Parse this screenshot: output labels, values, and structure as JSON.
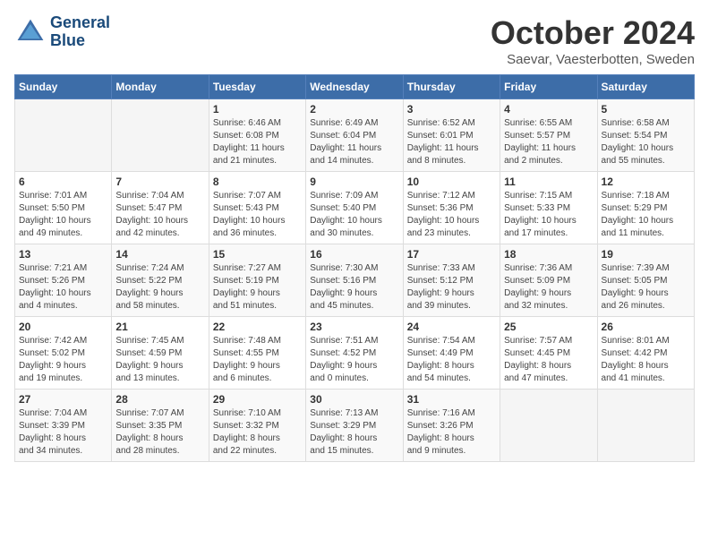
{
  "header": {
    "logo_line1": "General",
    "logo_line2": "Blue",
    "month": "October 2024",
    "location": "Saevar, Vaesterbotten, Sweden"
  },
  "weekdays": [
    "Sunday",
    "Monday",
    "Tuesday",
    "Wednesday",
    "Thursday",
    "Friday",
    "Saturday"
  ],
  "weeks": [
    [
      {
        "day": "",
        "info": ""
      },
      {
        "day": "",
        "info": ""
      },
      {
        "day": "1",
        "info": "Sunrise: 6:46 AM\nSunset: 6:08 PM\nDaylight: 11 hours\nand 21 minutes."
      },
      {
        "day": "2",
        "info": "Sunrise: 6:49 AM\nSunset: 6:04 PM\nDaylight: 11 hours\nand 14 minutes."
      },
      {
        "day": "3",
        "info": "Sunrise: 6:52 AM\nSunset: 6:01 PM\nDaylight: 11 hours\nand 8 minutes."
      },
      {
        "day": "4",
        "info": "Sunrise: 6:55 AM\nSunset: 5:57 PM\nDaylight: 11 hours\nand 2 minutes."
      },
      {
        "day": "5",
        "info": "Sunrise: 6:58 AM\nSunset: 5:54 PM\nDaylight: 10 hours\nand 55 minutes."
      }
    ],
    [
      {
        "day": "6",
        "info": "Sunrise: 7:01 AM\nSunset: 5:50 PM\nDaylight: 10 hours\nand 49 minutes."
      },
      {
        "day": "7",
        "info": "Sunrise: 7:04 AM\nSunset: 5:47 PM\nDaylight: 10 hours\nand 42 minutes."
      },
      {
        "day": "8",
        "info": "Sunrise: 7:07 AM\nSunset: 5:43 PM\nDaylight: 10 hours\nand 36 minutes."
      },
      {
        "day": "9",
        "info": "Sunrise: 7:09 AM\nSunset: 5:40 PM\nDaylight: 10 hours\nand 30 minutes."
      },
      {
        "day": "10",
        "info": "Sunrise: 7:12 AM\nSunset: 5:36 PM\nDaylight: 10 hours\nand 23 minutes."
      },
      {
        "day": "11",
        "info": "Sunrise: 7:15 AM\nSunset: 5:33 PM\nDaylight: 10 hours\nand 17 minutes."
      },
      {
        "day": "12",
        "info": "Sunrise: 7:18 AM\nSunset: 5:29 PM\nDaylight: 10 hours\nand 11 minutes."
      }
    ],
    [
      {
        "day": "13",
        "info": "Sunrise: 7:21 AM\nSunset: 5:26 PM\nDaylight: 10 hours\nand 4 minutes."
      },
      {
        "day": "14",
        "info": "Sunrise: 7:24 AM\nSunset: 5:22 PM\nDaylight: 9 hours\nand 58 minutes."
      },
      {
        "day": "15",
        "info": "Sunrise: 7:27 AM\nSunset: 5:19 PM\nDaylight: 9 hours\nand 51 minutes."
      },
      {
        "day": "16",
        "info": "Sunrise: 7:30 AM\nSunset: 5:16 PM\nDaylight: 9 hours\nand 45 minutes."
      },
      {
        "day": "17",
        "info": "Sunrise: 7:33 AM\nSunset: 5:12 PM\nDaylight: 9 hours\nand 39 minutes."
      },
      {
        "day": "18",
        "info": "Sunrise: 7:36 AM\nSunset: 5:09 PM\nDaylight: 9 hours\nand 32 minutes."
      },
      {
        "day": "19",
        "info": "Sunrise: 7:39 AM\nSunset: 5:05 PM\nDaylight: 9 hours\nand 26 minutes."
      }
    ],
    [
      {
        "day": "20",
        "info": "Sunrise: 7:42 AM\nSunset: 5:02 PM\nDaylight: 9 hours\nand 19 minutes."
      },
      {
        "day": "21",
        "info": "Sunrise: 7:45 AM\nSunset: 4:59 PM\nDaylight: 9 hours\nand 13 minutes."
      },
      {
        "day": "22",
        "info": "Sunrise: 7:48 AM\nSunset: 4:55 PM\nDaylight: 9 hours\nand 6 minutes."
      },
      {
        "day": "23",
        "info": "Sunrise: 7:51 AM\nSunset: 4:52 PM\nDaylight: 9 hours\nand 0 minutes."
      },
      {
        "day": "24",
        "info": "Sunrise: 7:54 AM\nSunset: 4:49 PM\nDaylight: 8 hours\nand 54 minutes."
      },
      {
        "day": "25",
        "info": "Sunrise: 7:57 AM\nSunset: 4:45 PM\nDaylight: 8 hours\nand 47 minutes."
      },
      {
        "day": "26",
        "info": "Sunrise: 8:01 AM\nSunset: 4:42 PM\nDaylight: 8 hours\nand 41 minutes."
      }
    ],
    [
      {
        "day": "27",
        "info": "Sunrise: 7:04 AM\nSunset: 3:39 PM\nDaylight: 8 hours\nand 34 minutes."
      },
      {
        "day": "28",
        "info": "Sunrise: 7:07 AM\nSunset: 3:35 PM\nDaylight: 8 hours\nand 28 minutes."
      },
      {
        "day": "29",
        "info": "Sunrise: 7:10 AM\nSunset: 3:32 PM\nDaylight: 8 hours\nand 22 minutes."
      },
      {
        "day": "30",
        "info": "Sunrise: 7:13 AM\nSunset: 3:29 PM\nDaylight: 8 hours\nand 15 minutes."
      },
      {
        "day": "31",
        "info": "Sunrise: 7:16 AM\nSunset: 3:26 PM\nDaylight: 8 hours\nand 9 minutes."
      },
      {
        "day": "",
        "info": ""
      },
      {
        "day": "",
        "info": ""
      }
    ]
  ]
}
